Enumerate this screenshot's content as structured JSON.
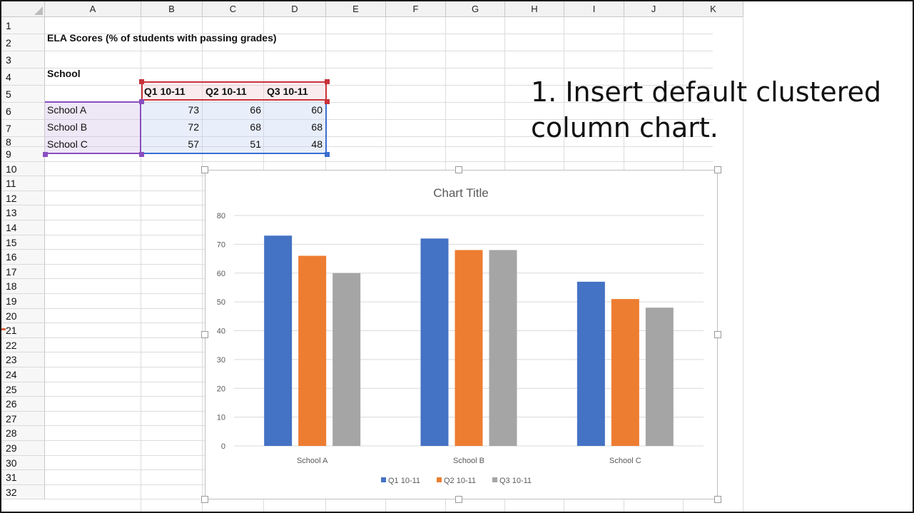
{
  "sheet": {
    "columns": [
      "A",
      "B",
      "C",
      "D",
      "E",
      "F",
      "G",
      "H",
      "I",
      "J",
      "K"
    ],
    "rows": [
      "1",
      "2",
      "3",
      "4",
      "5",
      "6",
      "7",
      "8",
      "9",
      "10",
      "11",
      "12",
      "13",
      "14",
      "15",
      "16",
      "17",
      "18",
      "19",
      "20",
      "21",
      "22",
      "23",
      "24",
      "25",
      "26",
      "27",
      "28",
      "29",
      "30",
      "31",
      "32"
    ],
    "cells": {
      "title": "ELA Scores (% of students with passing grades)",
      "school_label": "School",
      "headers": [
        "Q1 10-11",
        "Q2 10-11",
        "Q3 10-11"
      ],
      "schools": [
        "School A",
        "School B",
        "School C"
      ],
      "values": [
        [
          73,
          66,
          60
        ],
        [
          72,
          68,
          68
        ],
        [
          57,
          51,
          48
        ]
      ]
    }
  },
  "overlay_text": {
    "line1": "1. Insert default clustered",
    "line2": "column chart."
  },
  "chart_data": {
    "type": "bar",
    "title": "Chart Title",
    "categories": [
      "School A",
      "School B",
      "School C"
    ],
    "series": [
      {
        "name": "Q1 10-11",
        "values": [
          73,
          72,
          57
        ],
        "color": "#4472c4"
      },
      {
        "name": "Q2 10-11",
        "values": [
          66,
          68,
          51
        ],
        "color": "#ed7d31"
      },
      {
        "name": "Q3 10-11",
        "values": [
          60,
          68,
          48
        ],
        "color": "#a5a5a5"
      }
    ],
    "ylim": [
      0,
      80
    ],
    "yticks": [
      0,
      10,
      20,
      30,
      40,
      50,
      60,
      70,
      80
    ],
    "grid": true,
    "legend": "bottom"
  }
}
